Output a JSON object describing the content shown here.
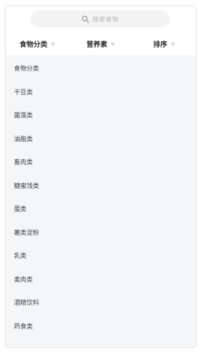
{
  "search": {
    "placeholder": "搜索食物"
  },
  "filters": [
    {
      "label": "食物分类",
      "chevron": "∨"
    },
    {
      "label": "营养素",
      "chevron": "∨"
    },
    {
      "label": "排序",
      "chevron": "∨"
    }
  ],
  "categories": [
    "食物分类",
    "干豆类",
    "菌藻类",
    "油脂类",
    "畜肉类",
    "糖蜜饯类",
    "蛋类",
    "薯类淀粉",
    "乳类",
    "禽肉类",
    "酒精饮料",
    "药食类"
  ],
  "colors": {
    "background": "#f5f6f8",
    "header": "#ffffff",
    "text": "#444444",
    "chevron": "#b5b5b5"
  }
}
